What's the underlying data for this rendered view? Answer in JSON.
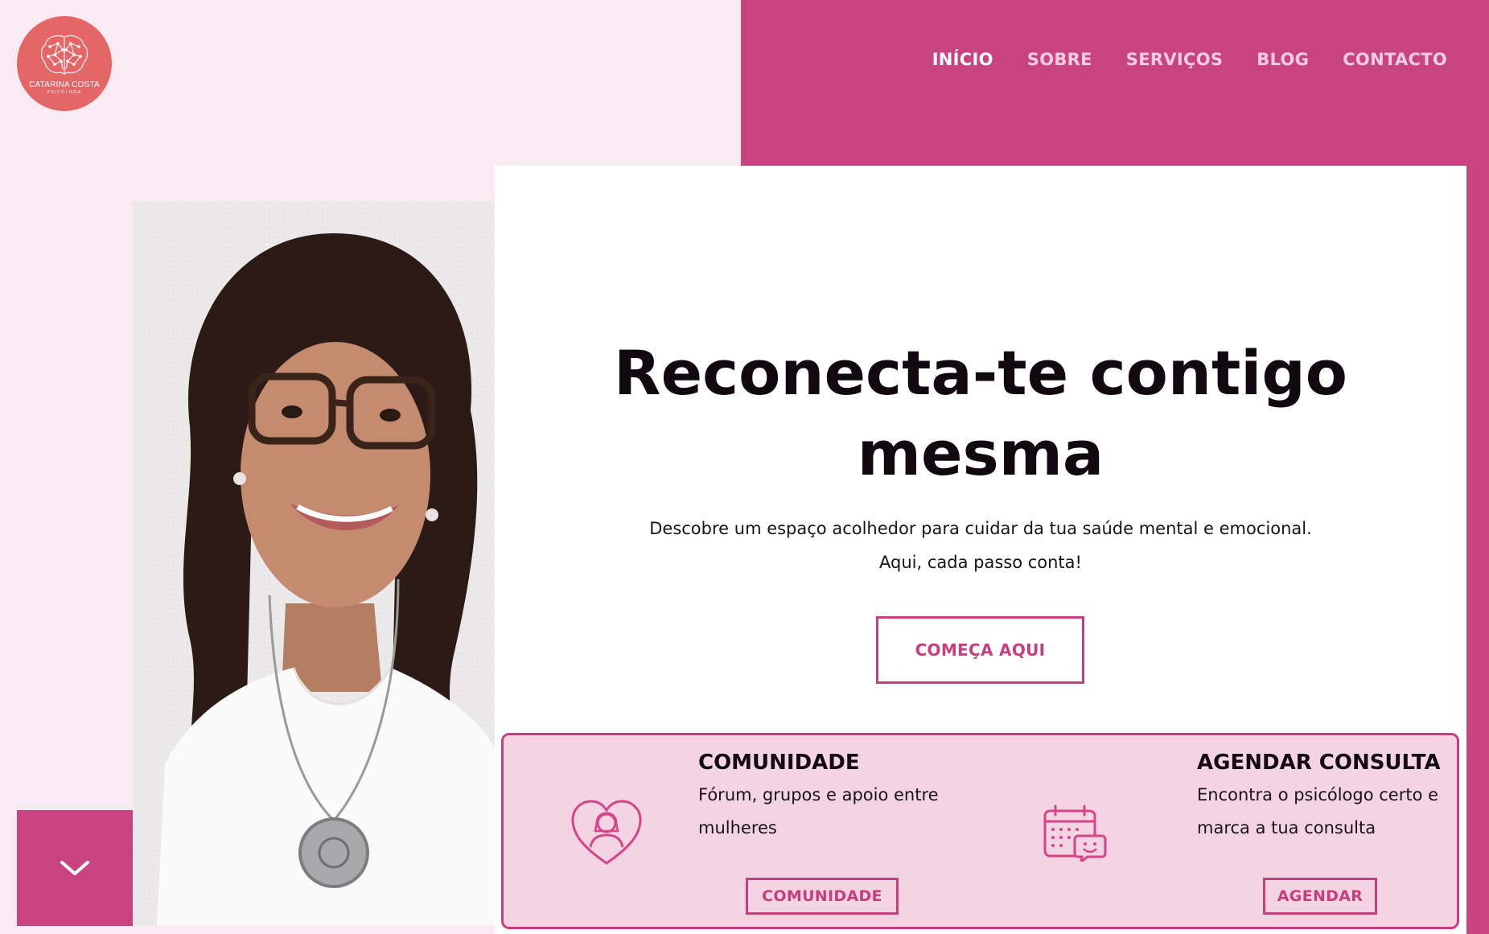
{
  "brand": {
    "name": "CATARINA COSTA",
    "subtitle": "PSICÓLOGA",
    "colors": {
      "primary": "#c84480",
      "logo": "#e46667",
      "page_bg": "#f8ebf1",
      "card_bg": "#f4d4e2"
    }
  },
  "nav": {
    "items": [
      {
        "label": "INÍCIO",
        "active": true
      },
      {
        "label": "SOBRE",
        "active": false
      },
      {
        "label": "SERVIÇOS",
        "active": false
      },
      {
        "label": "BLOG",
        "active": false
      },
      {
        "label": "CONTACTO",
        "active": false
      }
    ]
  },
  "hero": {
    "title_line1": "Reconecta-te contigo",
    "title_line2": "mesma",
    "subtitle_line1": "Descobre um espaço acolhedor para cuidar da tua saúde mental e emocional.",
    "subtitle_line2": "Aqui, cada passo conta!",
    "cta_label": "COMEÇA AQUI"
  },
  "features": [
    {
      "icon": "heart-person-icon",
      "title": "COMUNIDADE",
      "desc_line1": "Fórum, grupos e apoio entre",
      "desc_line2": "mulheres",
      "button_label": "COMUNIDADE"
    },
    {
      "icon": "calendar-chat-icon",
      "title": "AGENDAR CONSULTA",
      "desc_line1": "Encontra o psicólogo certo e",
      "desc_line2": "marca a tua consulta",
      "button_label": "AGENDAR"
    }
  ],
  "scroll": {
    "icon": "chevron-down-icon"
  },
  "photo": {
    "icon": "portrait-photo"
  }
}
